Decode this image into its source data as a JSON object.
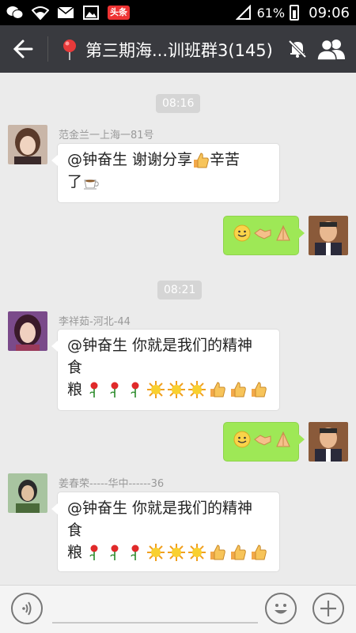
{
  "status_bar": {
    "battery": "61%",
    "time": "09:06",
    "toutiao_badge": "头条",
    "icons": [
      "wechat-icon",
      "wifi-icon",
      "mail-icon",
      "image-icon",
      "toutiao-icon",
      "signal-icon",
      "battery-icon"
    ]
  },
  "header": {
    "title": "第三期海...训班群3(145)",
    "icons": [
      "back-arrow-icon",
      "location-pin-icon",
      "mute-bell-icon",
      "group-members-icon"
    ]
  },
  "chat": {
    "messages": [
      {
        "type": "time",
        "text": "08:16"
      },
      {
        "type": "incoming",
        "sender": "范金兰一上海一81号",
        "line1": "@钟奋生 谢谢分享",
        "line1_tail": "辛苦",
        "line2": "了",
        "emojis": [
          "thumbs-up",
          "coffee"
        ]
      },
      {
        "type": "outgoing",
        "emojis": [
          "smile",
          "handshake",
          "pray"
        ]
      },
      {
        "type": "time",
        "text": "08:21"
      },
      {
        "type": "incoming",
        "sender": "李祥茹-河北-44",
        "line1": "@钟奋生 你就是我们的精神",
        "line2": "食",
        "line3": "粮",
        "emojis": [
          "rose",
          "rose",
          "rose",
          "sun",
          "sun",
          "sun",
          "thumbs-up",
          "thumbs-up",
          "thumbs-up"
        ]
      },
      {
        "type": "outgoing",
        "emojis": [
          "smile",
          "handshake",
          "pray"
        ]
      },
      {
        "type": "incoming",
        "sender": "姜春荣-----华中------36",
        "line1": "@钟奋生 你就是我们的精神",
        "line2": "食",
        "line3": "粮",
        "emojis": [
          "rose",
          "rose",
          "rose",
          "sun",
          "sun",
          "sun",
          "thumbs-up",
          "thumbs-up",
          "thumbs-up"
        ]
      }
    ]
  },
  "input_bar": {
    "icons": [
      "voice-icon",
      "emoji-icon",
      "plus-icon"
    ]
  },
  "colors": {
    "header_bg": "#393a3f",
    "chat_bg": "#ebebeb",
    "outgoing_bubble": "#9ee856",
    "incoming_bubble": "#ffffff",
    "time_badge": "#d5d5d5"
  }
}
